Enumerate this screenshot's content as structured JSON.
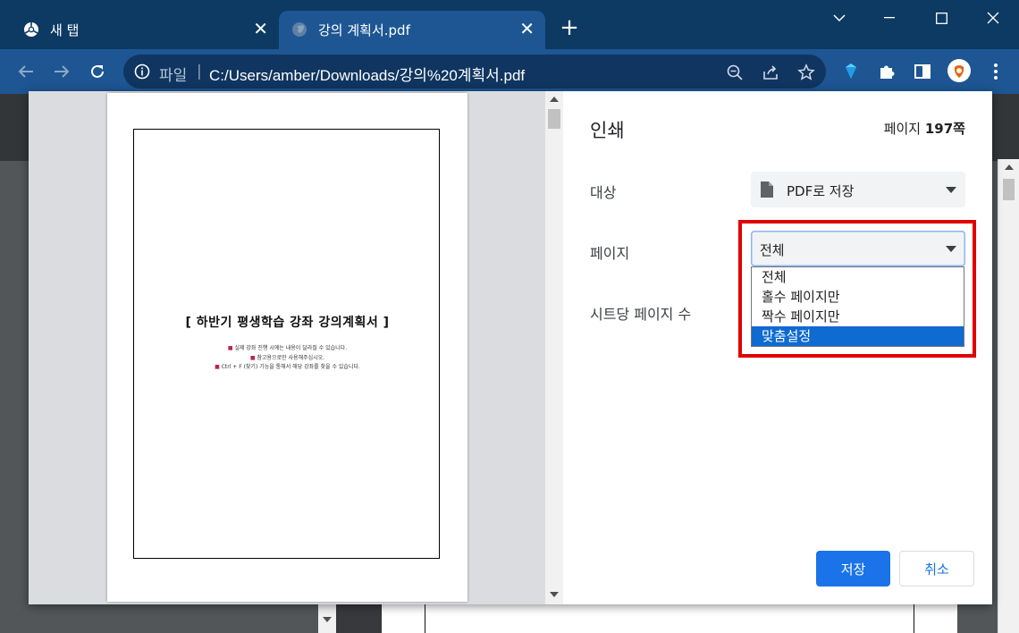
{
  "tabs": [
    {
      "title": "새 탭",
      "active": false
    },
    {
      "title": "강의 계획서.pdf",
      "active": true
    }
  ],
  "toolbar": {
    "scheme_label": "파일",
    "url": "C:/Users/amber/Downloads/강의%20계획서.pdf"
  },
  "preview": {
    "doc_title": "[ 하반기 평생학습 강좌 강의계획서 ]",
    "notes": [
      "실제 강좌 진행 시에는 내용이 달라질 수 있습니다.",
      "참고용으로만 사용해주십시오.",
      "Ctrl + F (찾기) 기능을 통해서 해당 강좌를 찾을 수 있습니다."
    ]
  },
  "print_dialog": {
    "title": "인쇄",
    "page_count_prefix": "페이지 ",
    "page_count": "197쪽",
    "destination_label": "대상",
    "destination_value": "PDF로 저장",
    "pages_label": "페이지",
    "pages_value": "전체",
    "pages_options": [
      "전체",
      "홀수 페이지만",
      "짝수 페이지만",
      "맞춤설정"
    ],
    "pages_per_sheet_label": "시트당 페이지 수",
    "save_button": "저장",
    "cancel_button": "취소"
  },
  "colors": {
    "accent": "#1a73e8",
    "highlight": "#e00000",
    "toolbar": "#1d5693",
    "tabstrip": "#0c3a63"
  }
}
